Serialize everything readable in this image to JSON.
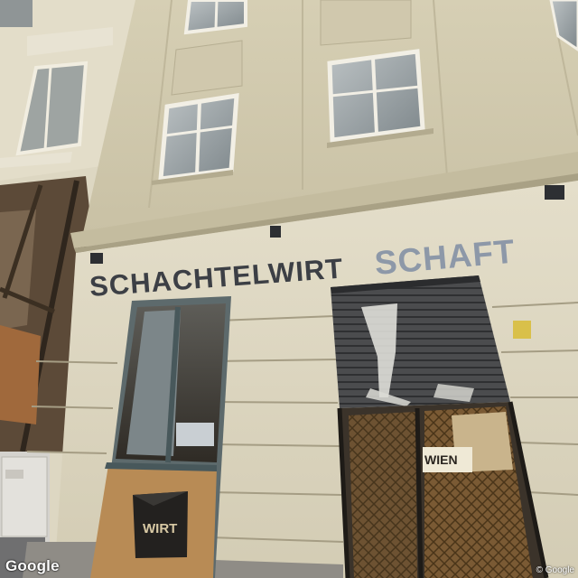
{
  "scene": {
    "storefront_sign_dark": "SCHACHTELWIRT",
    "storefront_sign_light": "SCHAFT",
    "window_sign": "WIRT",
    "door_sign": "WIEN"
  },
  "overlay": {
    "logo": "Google",
    "copyright": "© Google"
  },
  "colors": {
    "facade": "#d8d1b6",
    "sign_dark": "#3c3f45",
    "sign_light": "#8d98a8"
  }
}
